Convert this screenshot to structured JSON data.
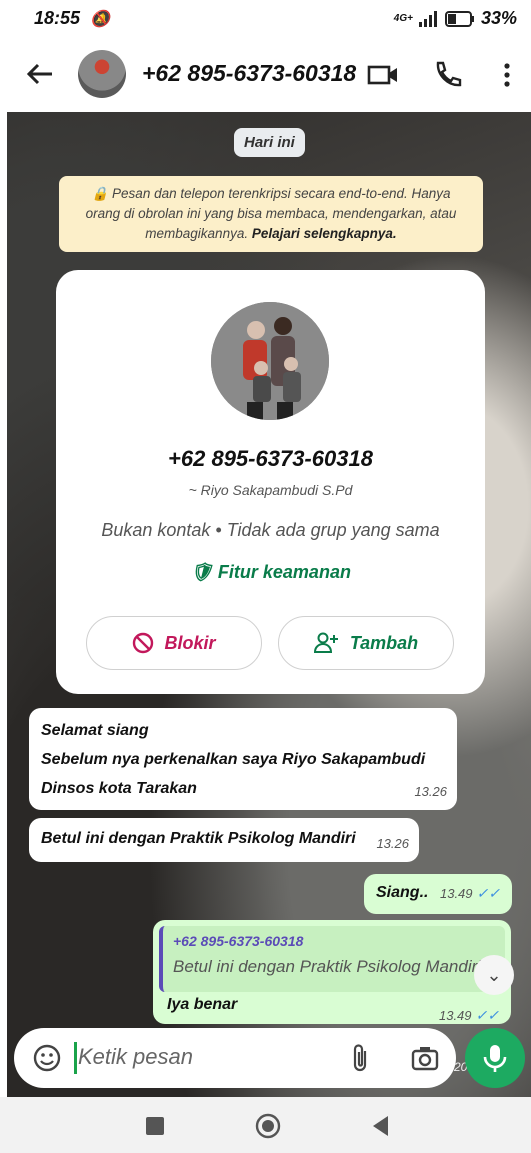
{
  "status": {
    "time": "18:55",
    "network": "4G+",
    "battery": "33%"
  },
  "header": {
    "title": "+62 895-6373-60318"
  },
  "chat": {
    "date_chip": "Hari ini",
    "encryption": {
      "text": "Pesan dan telepon terenkripsi secara end-to-end. Hanya orang di obrolan ini yang bisa membaca, mendengarkan, atau membagikannya.",
      "link": "Pelajari selengkapnya."
    },
    "contact_card": {
      "number": "+62 895-6373-60318",
      "alias": "~ Riyo Sakapambudi S.Pd",
      "info": "Bukan kontak • Tidak ada grup yang sama",
      "security": "Fitur keamanan",
      "block_label": "Blokir",
      "add_label": "Tambah"
    },
    "messages": [
      {
        "lines": [
          "Selamat siang",
          "Sebelum nya perkenalkan saya Riyo Sakapambudi",
          "Dinsos kota Tarakan"
        ],
        "time": "13.26"
      },
      {
        "lines": [
          "Betul ini dengan Praktik Psikolog Mandiri"
        ],
        "time": "13.26"
      },
      {
        "lines": [
          "Siang.."
        ],
        "time": "13.49"
      },
      {
        "reply_name": "+62 895-6373-60318",
        "reply_text": "Betul ini dengan Praktik Psikolog Mandiri",
        "lines": [
          "Iya benar"
        ],
        "time": "13.49"
      }
    ]
  },
  "composer": {
    "placeholder": "Ketik pesan",
    "partial_time": "20"
  },
  "colors": {
    "accent": "#1daa61",
    "outgoing": "#d9fdd3",
    "notice": "#fcefc9"
  }
}
